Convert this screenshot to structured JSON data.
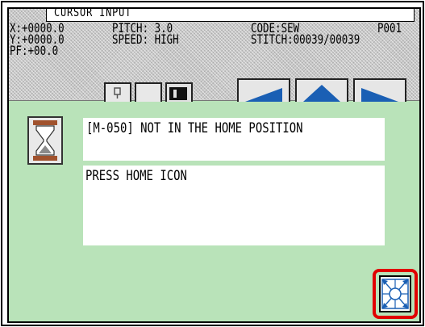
{
  "header": {
    "mode_title": "CURSOR INPUT",
    "x_coord": "X:+0000.0",
    "y_coord": "Y:+0000.0",
    "pf": "PF:+00.0",
    "pitch": "PITCH: 3.0",
    "speed": "SPEED: HIGH",
    "code": "CODE:SEW",
    "program": "P001",
    "stitch": "STITCH:00039/00039"
  },
  "toolbar": {
    "buttons": [
      {
        "icon": "presser-icon"
      },
      {
        "icon": "blank-icon"
      },
      {
        "icon": "machine-icon"
      },
      {
        "icon": "arrow-down-left-icon"
      },
      {
        "icon": "arrow-up-icon"
      },
      {
        "icon": "arrow-down-right-icon"
      }
    ]
  },
  "dialog": {
    "icon": "hourglass-icon",
    "error_message": "[M-050] NOT IN THE HOME POSITION",
    "instruction": "PRESS HOME ICON",
    "home_button_icon": "home-position-icon"
  },
  "colors": {
    "screen_background": "#b9e3b9",
    "arrow_blue": "#1a5fb4",
    "highlight_red": "#e00000"
  }
}
